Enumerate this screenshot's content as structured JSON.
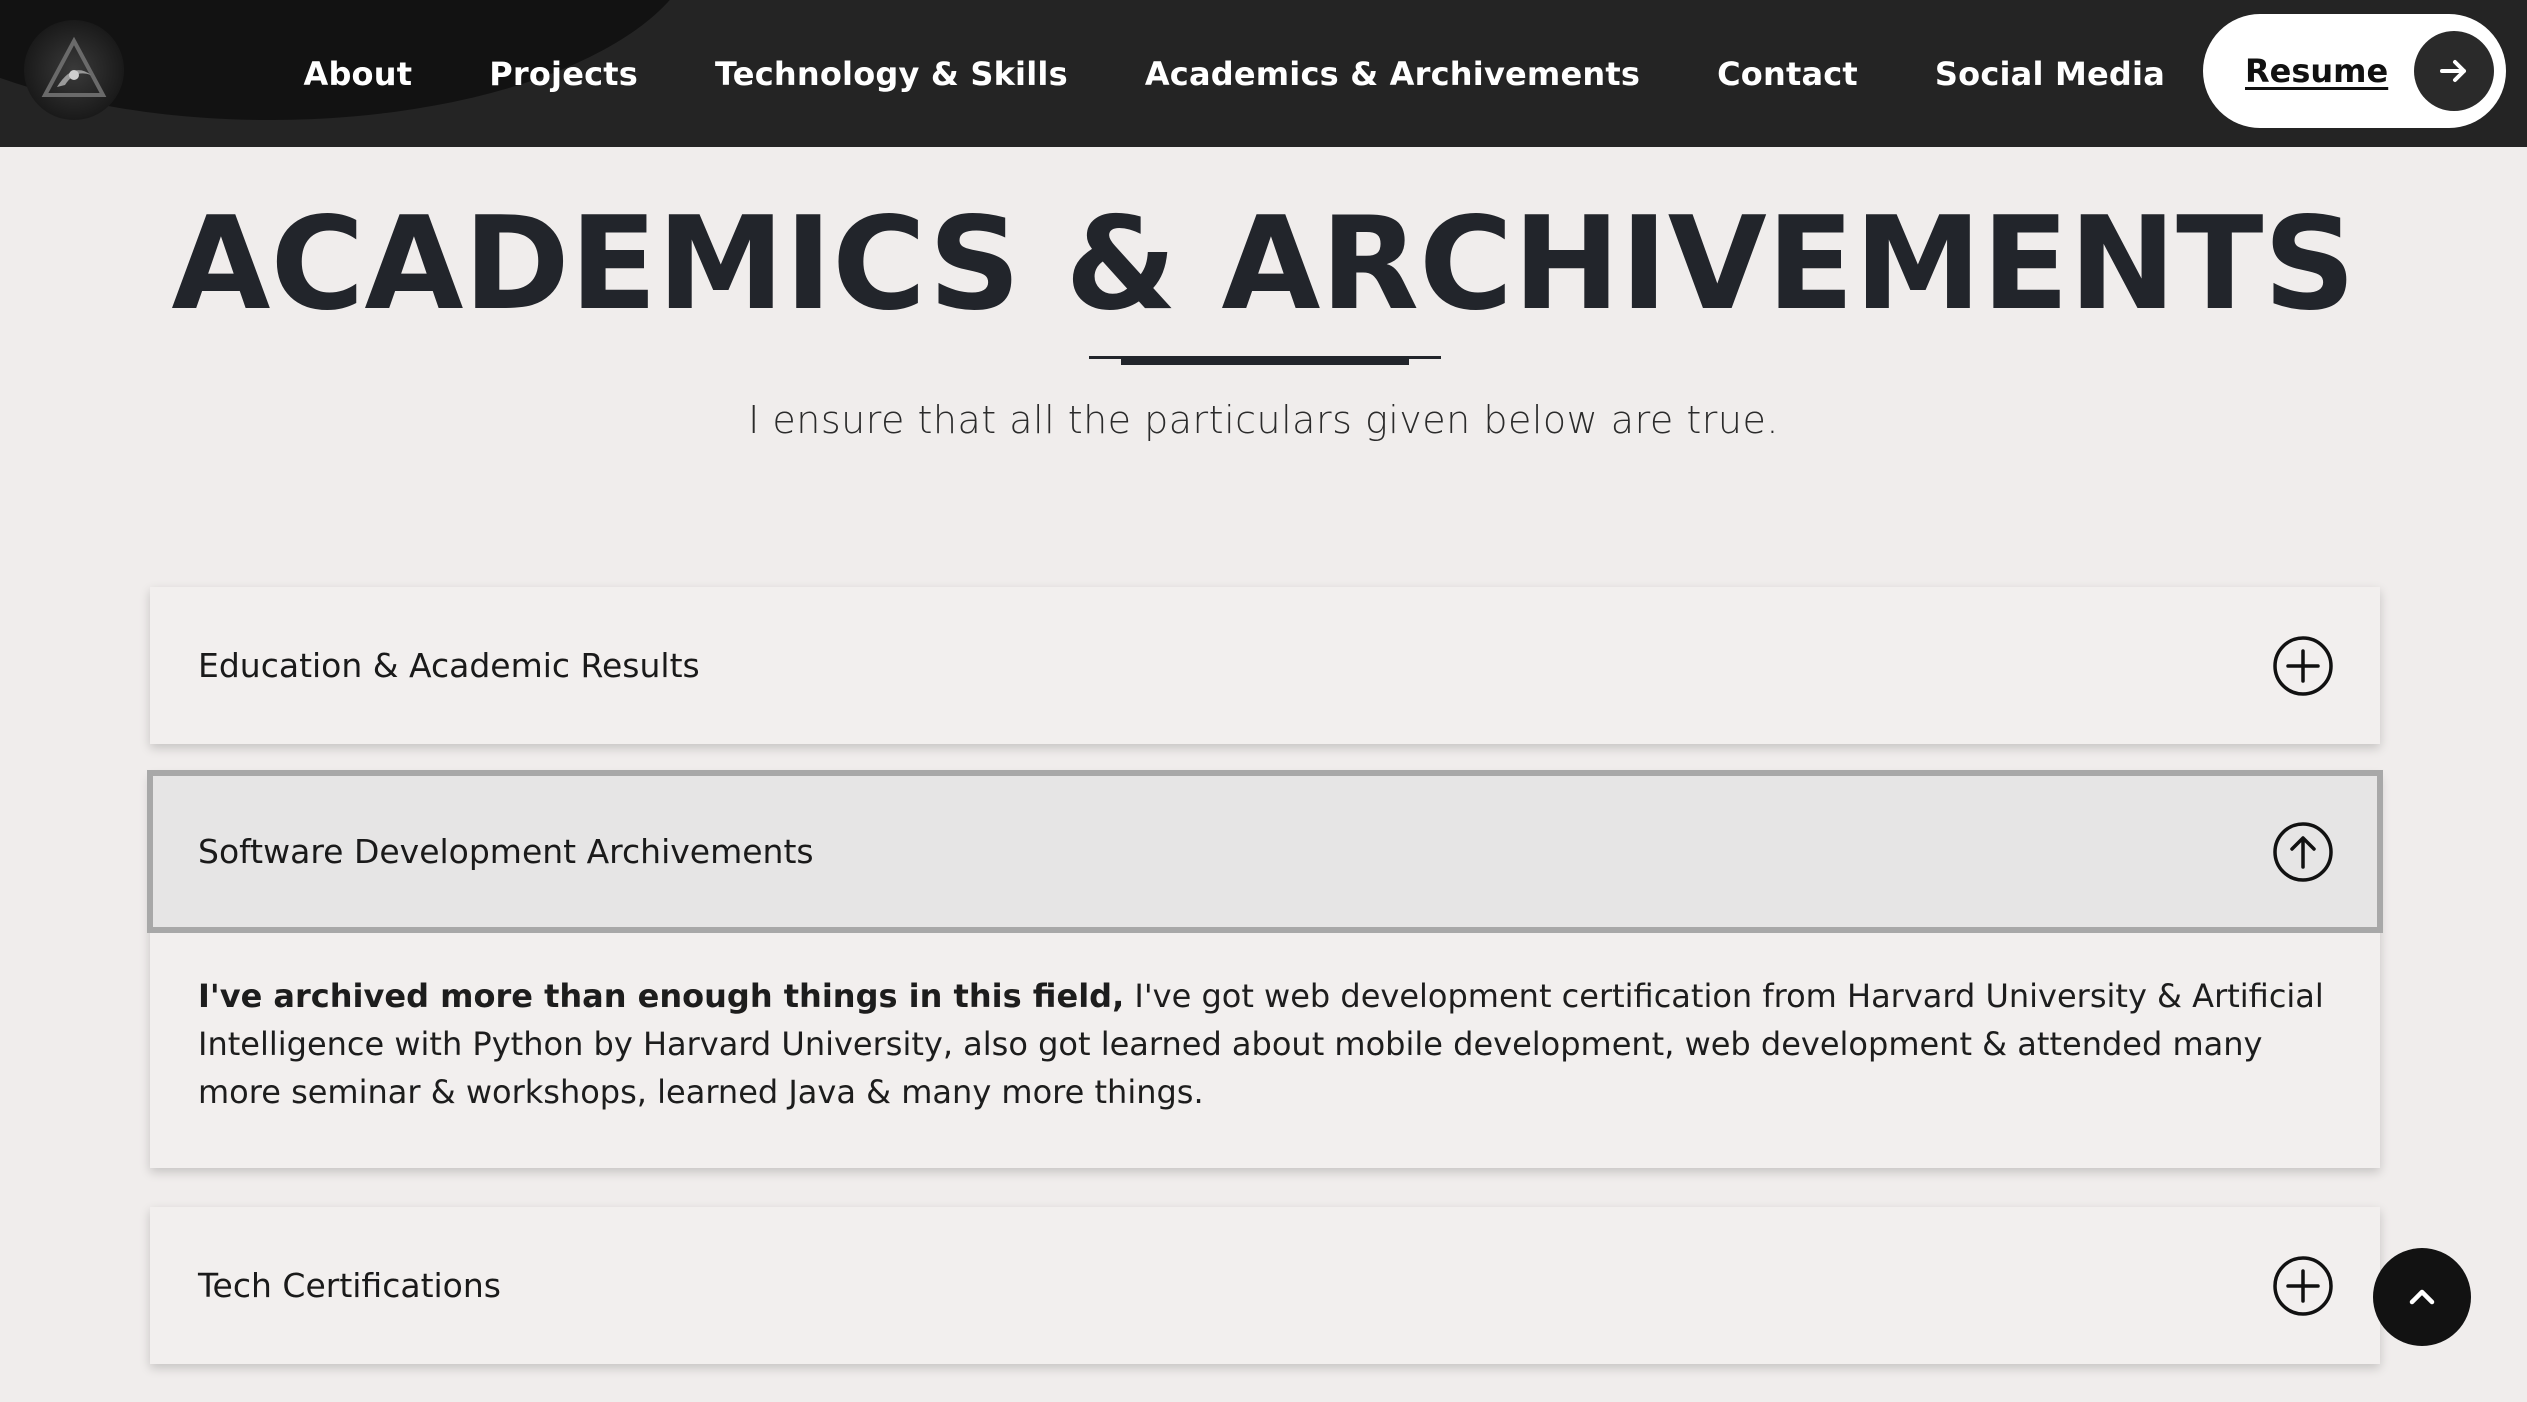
{
  "nav": {
    "links": [
      "About",
      "Projects",
      "Technology & Skills",
      "Academics & Archivements",
      "Contact",
      "Social Media"
    ],
    "resume_label": "Resume"
  },
  "header": {
    "title": "ACADEMICS & ARCHIVEMENTS",
    "subtitle": "I ensure that all the particulars given below are true."
  },
  "accordion": {
    "items": [
      {
        "label": "Education & Academic Results",
        "state": "collapsed",
        "icon": "plus-circle-icon"
      },
      {
        "label": "Software Development Archivements",
        "state": "expanded",
        "icon": "arrow-up-circle-icon",
        "body_bold": "I've archived more than enough things in this field,",
        "body_text": " I've got web development certification from Harvard University & Artificial Intelligence with Python by Harvard University, also got learned about mobile development, web development & attended many more seminar & workshops, learned Java & many more things."
      },
      {
        "label": "Tech Certifications",
        "state": "collapsed",
        "icon": "plus-circle-icon"
      }
    ]
  },
  "colors": {
    "navbar": "#242424",
    "page_bg": "#f0edec",
    "accent_dark": "#22252b"
  },
  "back_to_top_icon": "chevron-up-icon"
}
